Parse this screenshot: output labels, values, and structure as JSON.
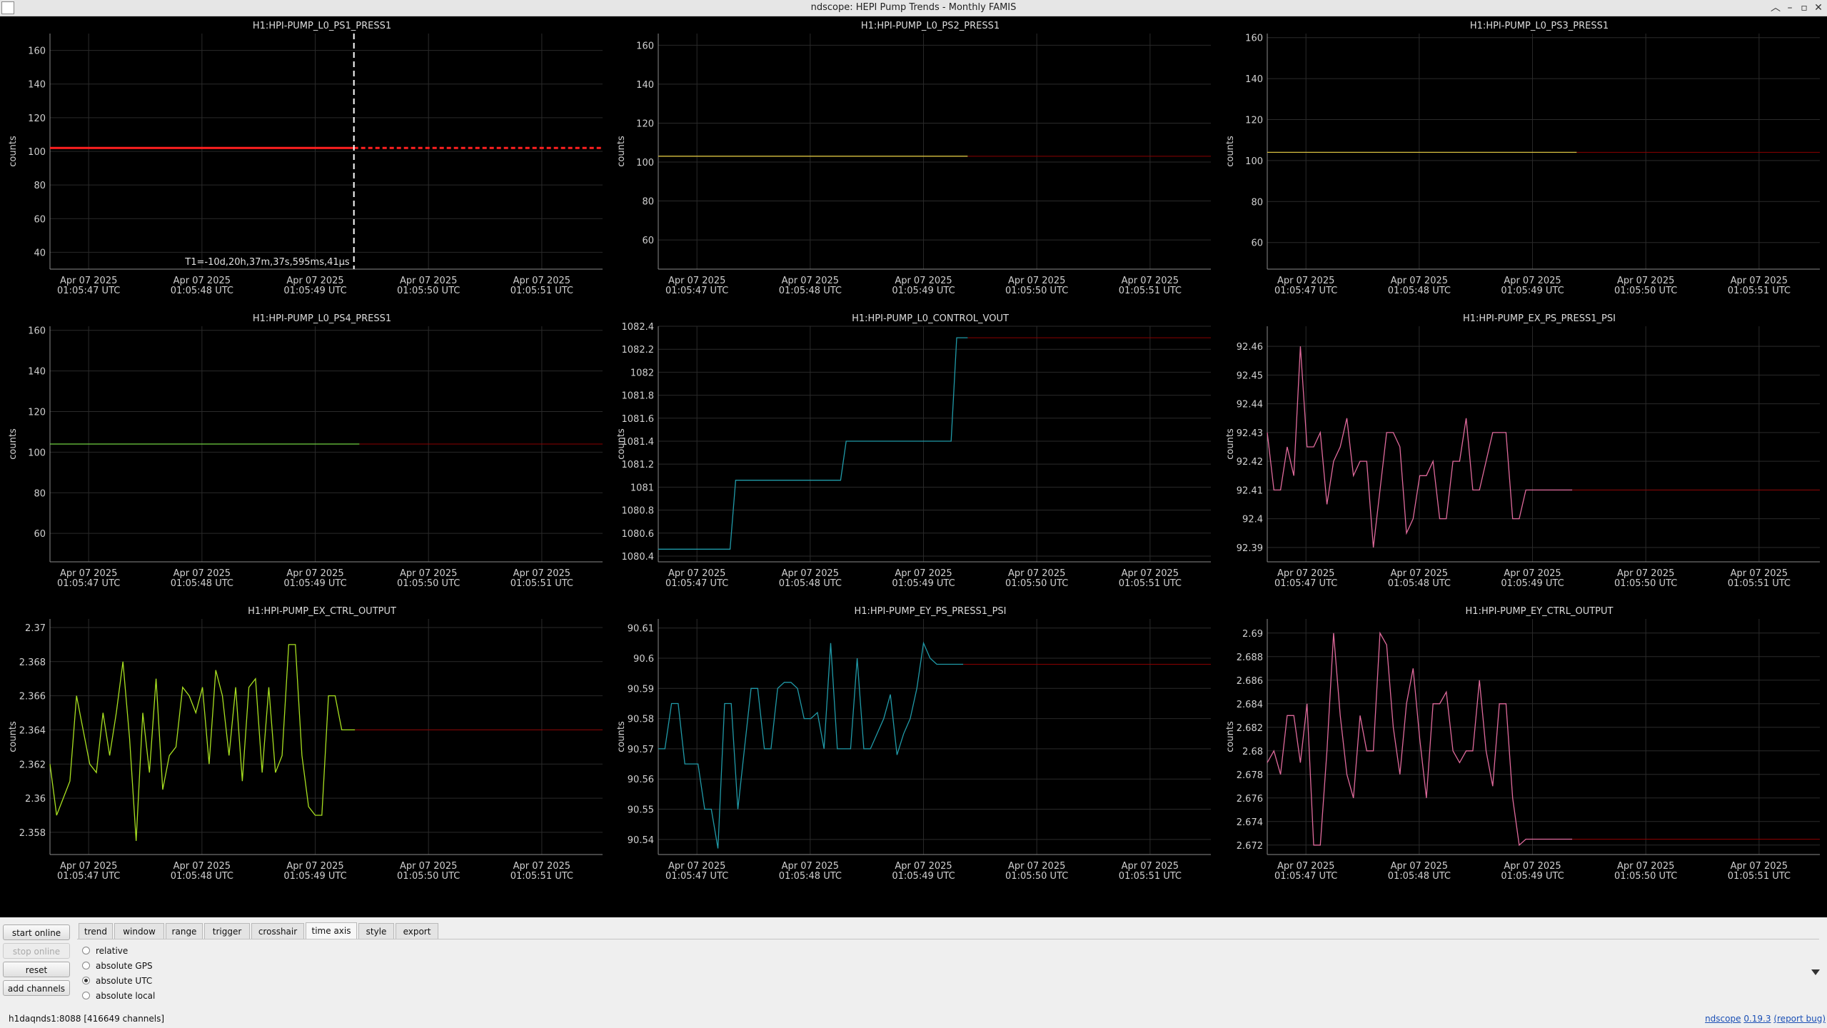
{
  "window": {
    "title": "ndscope: HEPI Pump Trends - Monthly FAMIS",
    "minimize_glyph": "–",
    "maximize_glyph": "▫",
    "close_glyph": "✕",
    "chevron_glyph": "︿"
  },
  "colors": {
    "plot_bg": "#000000",
    "grid": "#2a2a2a",
    "axis_text": "#d0d0d0",
    "future_line": "#8b0000",
    "series_red": "#ff2020",
    "series_yellow": "#d8c040",
    "series_green": "#70d040",
    "series_teal": "#209aa8",
    "series_pink": "#e06a9c",
    "series_lime": "#a8e020"
  },
  "x_axis_ticks": [
    [
      "Apr 07 2025",
      "01:05:47 UTC"
    ],
    [
      "Apr 07 2025",
      "01:05:48 UTC"
    ],
    [
      "Apr 07 2025",
      "01:05:49 UTC"
    ],
    [
      "Apr 07 2025",
      "01:05:50 UTC"
    ],
    [
      "Apr 07 2025",
      "01:05:51 UTC"
    ]
  ],
  "plots": [
    {
      "title": "H1:HPI-PUMP_L0_PS1_PRESS1",
      "ylabel": "counts",
      "yticks": [
        "40",
        "60",
        "80",
        "100",
        "120",
        "140",
        "160"
      ],
      "color": "#ff2020",
      "crosshair_label": "T1=-10d,20h,37m,37s,595ms,41µs"
    },
    {
      "title": "H1:HPI-PUMP_L0_PS2_PRESS1",
      "ylabel": "counts",
      "yticks": [
        "60",
        "80",
        "100",
        "120",
        "140",
        "160"
      ],
      "color": "#d8c040"
    },
    {
      "title": "H1:HPI-PUMP_L0_PS3_PRESS1",
      "ylabel": "counts",
      "yticks": [
        "60",
        "80",
        "100",
        "120",
        "140",
        "160"
      ],
      "color": "#d8c040"
    },
    {
      "title": "H1:HPI-PUMP_L0_PS4_PRESS1",
      "ylabel": "counts",
      "yticks": [
        "60",
        "80",
        "100",
        "120",
        "140",
        "160"
      ],
      "color": "#70d040"
    },
    {
      "title": "H1:HPI-PUMP_L0_CONTROL_VOUT",
      "ylabel": "counts",
      "yticks": [
        "1080.4",
        "1080.6",
        "1080.8",
        "1081",
        "1081.2",
        "1081.4",
        "1081.6",
        "1081.8",
        "1082",
        "1082.2",
        "1082.4"
      ],
      "color": "#209aa8"
    },
    {
      "title": "H1:HPI-PUMP_EX_PS_PRESS1_PSI",
      "ylabel": "counts",
      "yticks": [
        "92.39",
        "92.4",
        "92.41",
        "92.42",
        "92.43",
        "92.44",
        "92.45",
        "92.46"
      ],
      "color": "#e06a9c"
    },
    {
      "title": "H1:HPI-PUMP_EX_CTRL_OUTPUT",
      "ylabel": "counts",
      "yticks": [
        "2.358",
        "2.36",
        "2.362",
        "2.364",
        "2.366",
        "2.368",
        "2.37"
      ],
      "color": "#a8e020"
    },
    {
      "title": "H1:HPI-PUMP_EY_PS_PRESS1_PSI",
      "ylabel": "counts",
      "yticks": [
        "90.54",
        "90.55",
        "90.56",
        "90.57",
        "90.58",
        "90.59",
        "90.6",
        "90.61"
      ],
      "color": "#209aa8"
    },
    {
      "title": "H1:HPI-PUMP_EY_CTRL_OUTPUT",
      "ylabel": "counts",
      "yticks": [
        "2.672",
        "2.674",
        "2.676",
        "2.678",
        "2.68",
        "2.682",
        "2.684",
        "2.686",
        "2.688",
        "2.69"
      ],
      "color": "#e06a9c"
    }
  ],
  "chart_data": [
    {
      "type": "line",
      "title": "H1:HPI-PUMP_L0_PS1_PRESS1",
      "ylabel": "counts",
      "ylim": [
        30,
        170
      ],
      "x": [
        0,
        0.1,
        0.2,
        0.3,
        0.4,
        0.5,
        0.55
      ],
      "values": [
        102,
        102,
        102,
        102,
        102,
        102,
        102
      ]
    },
    {
      "type": "line",
      "title": "H1:HPI-PUMP_L0_PS2_PRESS1",
      "ylabel": "counts",
      "ylim": [
        45,
        166
      ],
      "x": [
        0,
        0.15,
        0.3,
        0.45,
        0.56
      ],
      "values": [
        103,
        103,
        103,
        103,
        103
      ]
    },
    {
      "type": "line",
      "title": "H1:HPI-PUMP_L0_PS3_PRESS1",
      "ylabel": "counts",
      "ylim": [
        47,
        162
      ],
      "x": [
        0,
        0.15,
        0.3,
        0.45,
        0.56
      ],
      "values": [
        104,
        104,
        104,
        104,
        104
      ]
    },
    {
      "type": "line",
      "title": "H1:HPI-PUMP_L0_PS4_PRESS1",
      "ylabel": "counts",
      "ylim": [
        46,
        162
      ],
      "x": [
        0,
        0.15,
        0.3,
        0.45,
        0.56
      ],
      "values": [
        104,
        104,
        104,
        104,
        104
      ]
    },
    {
      "type": "line",
      "title": "H1:HPI-PUMP_L0_CONTROL_VOUT",
      "ylabel": "counts",
      "ylim": [
        1080.35,
        1082.4
      ],
      "x": [
        0,
        0.13,
        0.14,
        0.33,
        0.34,
        0.53,
        0.54,
        0.56
      ],
      "values": [
        1080.46,
        1080.46,
        1081.06,
        1081.06,
        1081.4,
        1081.4,
        1082.3,
        1082.3
      ]
    },
    {
      "type": "line",
      "title": "H1:HPI-PUMP_EX_PS_PRESS1_PSI",
      "ylabel": "counts",
      "ylim": [
        92.385,
        92.467
      ],
      "x": [
        0,
        0.012,
        0.024,
        0.036,
        0.048,
        0.06,
        0.072,
        0.084,
        0.096,
        0.108,
        0.12,
        0.132,
        0.144,
        0.156,
        0.168,
        0.18,
        0.192,
        0.204,
        0.216,
        0.228,
        0.24,
        0.252,
        0.264,
        0.276,
        0.288,
        0.3,
        0.312,
        0.324,
        0.336,
        0.348,
        0.36,
        0.372,
        0.384,
        0.396,
        0.408,
        0.42,
        0.432,
        0.444,
        0.456,
        0.468,
        0.48,
        0.492,
        0.504,
        0.516,
        0.528,
        0.54,
        0.552
      ],
      "values": [
        92.43,
        92.41,
        92.41,
        92.425,
        92.415,
        92.46,
        92.425,
        92.425,
        92.43,
        92.405,
        92.42,
        92.425,
        92.435,
        92.415,
        92.42,
        92.42,
        92.39,
        92.41,
        92.43,
        92.43,
        92.425,
        92.395,
        92.4,
        92.415,
        92.415,
        92.42,
        92.4,
        92.4,
        92.42,
        92.42,
        92.435,
        92.41,
        92.41,
        92.42,
        92.43,
        92.43,
        92.43,
        92.4,
        92.4,
        92.41,
        92.41,
        92.41,
        92.41,
        92.41,
        92.41,
        92.41,
        92.41
      ]
    },
    {
      "type": "line",
      "title": "H1:HPI-PUMP_EX_CTRL_OUTPUT",
      "ylabel": "counts",
      "ylim": [
        2.3567,
        2.3705
      ],
      "x": [
        0,
        0.012,
        0.024,
        0.036,
        0.048,
        0.06,
        0.072,
        0.084,
        0.096,
        0.108,
        0.12,
        0.132,
        0.144,
        0.156,
        0.168,
        0.18,
        0.192,
        0.204,
        0.216,
        0.228,
        0.24,
        0.252,
        0.264,
        0.276,
        0.288,
        0.3,
        0.312,
        0.324,
        0.336,
        0.348,
        0.36,
        0.372,
        0.384,
        0.396,
        0.408,
        0.42,
        0.432,
        0.444,
        0.456,
        0.468,
        0.48,
        0.492,
        0.504,
        0.516,
        0.528,
        0.54,
        0.552
      ],
      "values": [
        2.362,
        2.359,
        2.36,
        2.361,
        2.366,
        2.364,
        2.362,
        2.3615,
        2.365,
        2.3625,
        2.365,
        2.368,
        2.3635,
        2.3575,
        2.365,
        2.3615,
        2.367,
        2.3605,
        2.3625,
        2.363,
        2.3665,
        2.366,
        2.365,
        2.3665,
        2.362,
        2.3675,
        2.366,
        2.3625,
        2.3665,
        2.361,
        2.3665,
        2.367,
        2.3615,
        2.3665,
        2.3615,
        2.3625,
        2.369,
        2.369,
        2.3625,
        2.3595,
        2.359,
        2.359,
        2.366,
        2.366,
        2.364,
        2.364,
        2.364
      ]
    },
    {
      "type": "line",
      "title": "H1:HPI-PUMP_EY_PS_PRESS1_PSI",
      "ylabel": "counts",
      "ylim": [
        90.535,
        90.613
      ],
      "x": [
        0,
        0.012,
        0.024,
        0.036,
        0.048,
        0.06,
        0.072,
        0.084,
        0.096,
        0.108,
        0.12,
        0.132,
        0.144,
        0.156,
        0.168,
        0.18,
        0.192,
        0.204,
        0.216,
        0.228,
        0.24,
        0.252,
        0.264,
        0.276,
        0.288,
        0.3,
        0.312,
        0.324,
        0.336,
        0.348,
        0.36,
        0.372,
        0.384,
        0.396,
        0.408,
        0.42,
        0.432,
        0.444,
        0.456,
        0.468,
        0.48,
        0.492,
        0.504,
        0.516,
        0.528,
        0.54,
        0.552
      ],
      "values": [
        90.57,
        90.57,
        90.585,
        90.585,
        90.565,
        90.565,
        90.565,
        90.55,
        90.55,
        90.537,
        90.585,
        90.585,
        90.55,
        90.57,
        90.59,
        90.59,
        90.57,
        90.57,
        90.59,
        90.592,
        90.592,
        90.59,
        90.58,
        90.58,
        90.582,
        90.57,
        90.605,
        90.57,
        90.57,
        90.57,
        90.6,
        90.57,
        90.57,
        90.575,
        90.58,
        90.588,
        90.568,
        90.575,
        90.58,
        90.59,
        90.605,
        90.6,
        90.598,
        90.598,
        90.598,
        90.598,
        90.598
      ]
    },
    {
      "type": "line",
      "title": "H1:HPI-PUMP_EY_CTRL_OUTPUT",
      "ylabel": "counts",
      "ylim": [
        2.6712,
        2.6912
      ],
      "x": [
        0,
        0.012,
        0.024,
        0.036,
        0.048,
        0.06,
        0.072,
        0.084,
        0.096,
        0.108,
        0.12,
        0.132,
        0.144,
        0.156,
        0.168,
        0.18,
        0.192,
        0.204,
        0.216,
        0.228,
        0.24,
        0.252,
        0.264,
        0.276,
        0.288,
        0.3,
        0.312,
        0.324,
        0.336,
        0.348,
        0.36,
        0.372,
        0.384,
        0.396,
        0.408,
        0.42,
        0.432,
        0.444,
        0.456,
        0.468,
        0.48,
        0.492,
        0.504,
        0.516,
        0.528,
        0.54,
        0.552
      ],
      "values": [
        2.679,
        2.68,
        2.678,
        2.683,
        2.683,
        2.679,
        2.684,
        2.672,
        2.672,
        2.68,
        2.69,
        2.683,
        2.678,
        2.676,
        2.683,
        2.68,
        2.68,
        2.69,
        2.689,
        2.682,
        2.678,
        2.684,
        2.687,
        2.681,
        2.676,
        2.684,
        2.684,
        2.685,
        2.68,
        2.679,
        2.68,
        2.68,
        2.686,
        2.68,
        2.677,
        2.684,
        2.684,
        2.676,
        2.672,
        2.6725,
        2.6725,
        2.6725,
        2.6725,
        2.6725,
        2.6725,
        2.6725,
        2.6725
      ]
    }
  ],
  "controls": {
    "start_online": "start online",
    "stop_online": "stop online",
    "reset": "reset",
    "add_channels": "add channels",
    "tabs": [
      "trend",
      "window",
      "range",
      "trigger",
      "crosshair",
      "time axis",
      "style",
      "export"
    ],
    "active_tab": "time axis",
    "time_axis_options": [
      "relative",
      "absolute GPS",
      "absolute UTC",
      "absolute local"
    ],
    "selected_option": "absolute UTC"
  },
  "status": {
    "server": "h1daqnds1:8088  [416649 channels]",
    "app_name": "ndscope",
    "version": "0.19.3",
    "report_bug": "(report bug)"
  }
}
